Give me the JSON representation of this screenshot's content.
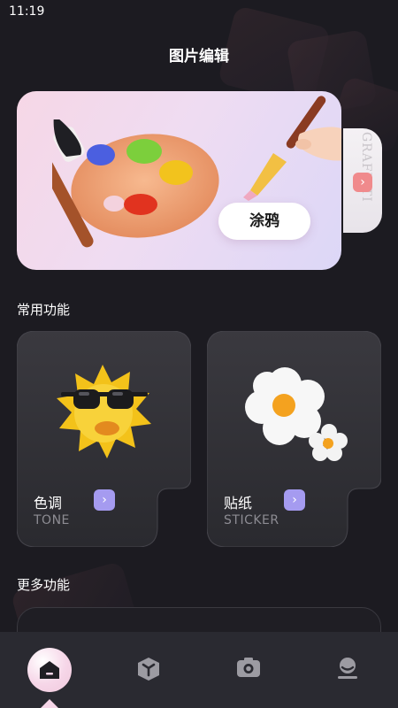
{
  "status_bar": {
    "time": "11:19"
  },
  "header": {
    "title": "图片编辑"
  },
  "banner": {
    "button_label": "涂鸦",
    "peek_text": "GRAFFITI",
    "peek_arrow": "›"
  },
  "common_section": {
    "title": "常用功能"
  },
  "cards": [
    {
      "name": "色调",
      "subtitle": "TONE",
      "arrow": "›",
      "icon": "sun-sunglasses-icon"
    },
    {
      "name": "贴纸",
      "subtitle": "STICKER",
      "arrow": "›",
      "icon": "flower-icon"
    }
  ],
  "more_section": {
    "title": "更多功能"
  },
  "tab_bar": {
    "items": [
      {
        "icon": "home-icon",
        "active": true
      },
      {
        "icon": "cube-icon",
        "active": false
      },
      {
        "icon": "camera-icon",
        "active": false
      },
      {
        "icon": "profile-icon",
        "active": false
      }
    ]
  },
  "colors": {
    "background": "#1c1b21",
    "card": "#2e2d33",
    "accent_purple": "#a59bf0",
    "accent_coral": "#f08a8c"
  }
}
